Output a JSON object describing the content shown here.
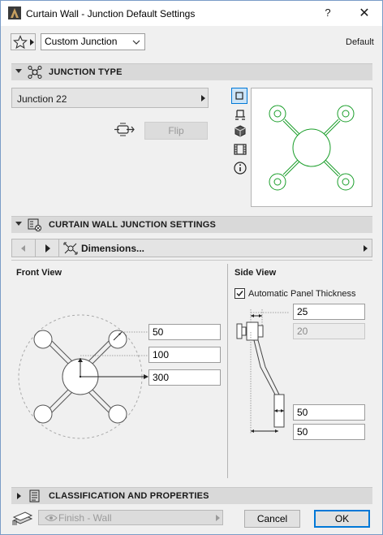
{
  "window": {
    "title": "Curtain Wall - Junction Default Settings",
    "help_label": "?",
    "close_label": "✕"
  },
  "toolbar": {
    "favorites_icon": "star-icon",
    "preset_value": "Custom Junction",
    "default_label": "Default"
  },
  "junction_type": {
    "header": "JUNCTION TYPE",
    "selected": "Junction 22",
    "flip_label": "Flip",
    "preview_modes": [
      "plan-view-icon",
      "elevation-view-icon",
      "3d-view-icon",
      "film-view-icon",
      "info-icon"
    ]
  },
  "settings": {
    "header": "CURTAIN WALL JUNCTION SETTINGS",
    "page_label": "Dimensions...",
    "front_view": {
      "title": "Front View",
      "values": [
        "50",
        "100",
        "300"
      ]
    },
    "side_view": {
      "title": "Side View",
      "auto_thickness_label": "Automatic Panel Thickness",
      "auto_thickness_checked": true,
      "values": [
        "25",
        "20",
        "50",
        "50"
      ]
    }
  },
  "classification": {
    "header": "CLASSIFICATION AND PROPERTIES"
  },
  "footer": {
    "layer_value": "Finish - Wall",
    "cancel_label": "Cancel",
    "ok_label": "OK"
  },
  "colors": {
    "accent_border": "#0078d7",
    "preview_green": "#1a9e2a",
    "header_bg": "#d9d9d9"
  }
}
